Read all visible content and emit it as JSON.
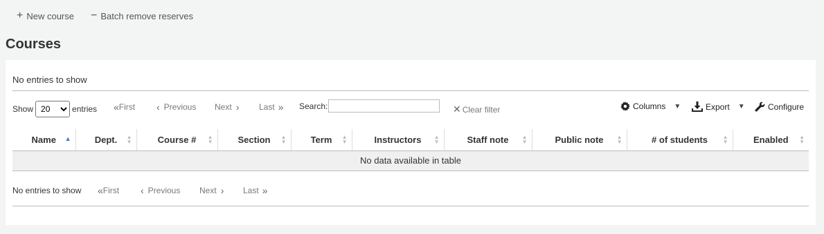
{
  "toolbar": {
    "new_course": "New course",
    "batch_remove": "Batch remove reserves"
  },
  "page_title": "Courses",
  "table_info": {
    "top": "No entries to show",
    "bottom": "No entries to show"
  },
  "length": {
    "show_label": "Show",
    "value": "20",
    "entries_label": "entries"
  },
  "pagination": {
    "first": "First",
    "previous": "Previous",
    "next": "Next",
    "last": "Last"
  },
  "search": {
    "label": "Search:",
    "value": "",
    "clear_filter": "Clear filter"
  },
  "actions": {
    "columns": "Columns",
    "export": "Export",
    "configure": "Configure"
  },
  "table": {
    "columns": [
      "Name",
      "Dept.",
      "Course #",
      "Section",
      "Term",
      "Instructors",
      "Staff note",
      "Public note",
      "# of students",
      "Enabled"
    ],
    "sorted_column": "Name",
    "empty_message": "No data available in table"
  },
  "colors": {
    "page_bg": "#f3f4f4",
    "sort_active": "#2e7bd8"
  }
}
